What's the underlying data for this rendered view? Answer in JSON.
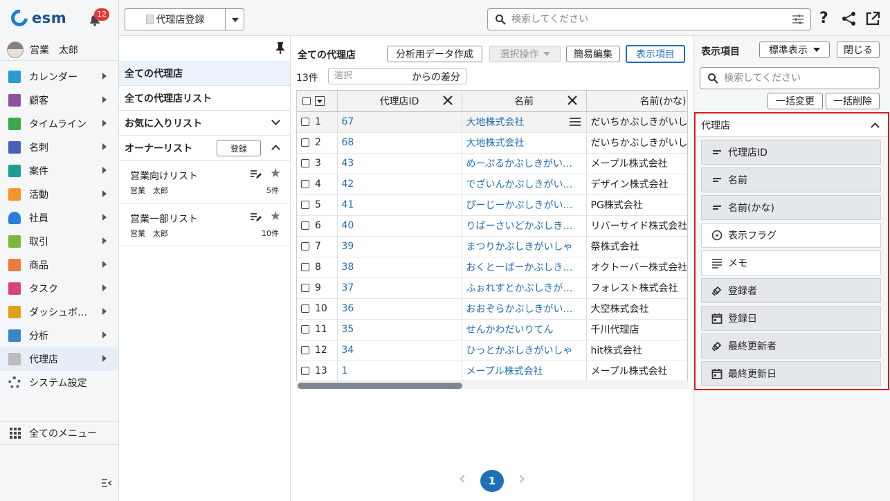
{
  "app": {
    "logo_text": "esm",
    "notification_count": "12"
  },
  "user": {
    "name": "営業　太郎"
  },
  "nav": {
    "items": [
      {
        "label": "カレンダー",
        "icon": "calendar-icon",
        "color": "#2a9bd6",
        "arrow": true
      },
      {
        "label": "顧客",
        "icon": "building-icon",
        "color": "#8e4f9e",
        "arrow": true
      },
      {
        "label": "タイムライン",
        "icon": "chat-icon",
        "color": "#3ba84a",
        "arrow": true
      },
      {
        "label": "名刺",
        "icon": "card-icon",
        "color": "#4a5fb8",
        "arrow": true
      },
      {
        "label": "案件",
        "icon": "folder-icon",
        "color": "#1f9e8e",
        "arrow": true
      },
      {
        "label": "活動",
        "icon": "clipboard-icon",
        "color": "#f0962a",
        "arrow": true
      },
      {
        "label": "社員",
        "icon": "person-icon",
        "color": "#2a7fd6",
        "arrow": true
      },
      {
        "label": "取引",
        "icon": "ledger-icon",
        "color": "#7bb83a",
        "arrow": true
      },
      {
        "label": "商品",
        "icon": "box-icon",
        "color": "#ef7a3a",
        "arrow": true
      },
      {
        "label": "タスク",
        "icon": "check-icon",
        "color": "#d6457a",
        "arrow": true
      },
      {
        "label": "ダッシュボ…",
        "icon": "dashboard-icon",
        "color": "#e0a01a",
        "arrow": true
      },
      {
        "label": "分析",
        "icon": "chart-icon",
        "color": "#3a86c8",
        "arrow": true
      },
      {
        "label": "代理店",
        "icon": "document-icon",
        "color": "#bcbcbc",
        "arrow": true
      },
      {
        "label": "システム設定",
        "icon": "gear-icon",
        "color": "#5a6170",
        "arrow": false
      }
    ],
    "all_menu": "全てのメニュー"
  },
  "topbar": {
    "new_button": "代理店登録",
    "search_placeholder": "検索してください",
    "help": "?"
  },
  "lists": {
    "all": "全ての代理店",
    "all_list": "全ての代理店リスト",
    "favorites": "お気に入りリスト",
    "owner": "オーナーリスト",
    "register": "登録",
    "owner_lists": [
      {
        "name": "営業向けリスト",
        "user": "営業　太郎",
        "count": "5件"
      },
      {
        "name": "営業一部リスト",
        "user": "営業　太郎",
        "count": "10件"
      }
    ]
  },
  "main": {
    "title": "全ての代理店",
    "btn_analysis": "分析用データ作成",
    "btn_select": "選択操作",
    "btn_quickedit": "簡易編集",
    "btn_display": "表示項目",
    "count": "13件",
    "diff_placeholder": "選択",
    "diff_suffix": "からの差分",
    "columns": [
      "代理店ID",
      "名前",
      "名前(かな)"
    ],
    "rows": [
      {
        "n": "1",
        "id": "67",
        "name": "大地株式会社",
        "kana": "だいちかぶしきがいしゃ"
      },
      {
        "n": "2",
        "id": "68",
        "name": "大地株式会社",
        "kana": "だいちかぶしきがいしゃ"
      },
      {
        "n": "3",
        "id": "43",
        "name": "めーぷるかぶしきがいしゃ",
        "kana": "メープル株式会社"
      },
      {
        "n": "4",
        "id": "42",
        "name": "でざいんかぶしきがいしゃ",
        "kana": "デザイン株式会社"
      },
      {
        "n": "5",
        "id": "41",
        "name": "ぴーじーかぶしきがいしゃ",
        "kana": "PG株式会社"
      },
      {
        "n": "6",
        "id": "40",
        "name": "りばーさいどかぶしきがいしゃ",
        "kana": "リバーサイド株式会社"
      },
      {
        "n": "7",
        "id": "39",
        "name": "まつりかぶしきがいしゃ",
        "kana": "祭株式会社"
      },
      {
        "n": "8",
        "id": "38",
        "name": "おくとーばーかぶしきがいしゃ",
        "kana": "オクトーバー株式会社"
      },
      {
        "n": "9",
        "id": "37",
        "name": "ふぉれすとかぶしきがいしゃ",
        "kana": "フォレスト株式会社"
      },
      {
        "n": "10",
        "id": "36",
        "name": "おおぞらかぶしきがいしゃ",
        "kana": "大空株式会社"
      },
      {
        "n": "11",
        "id": "35",
        "name": "せんかわだいりてん",
        "kana": "千川代理店"
      },
      {
        "n": "12",
        "id": "34",
        "name": "ひっとかぶしきがいしゃ",
        "kana": "hit株式会社"
      },
      {
        "n": "13",
        "id": "1",
        "name": "メープル株式会社",
        "kana": "メープル株式会社"
      }
    ],
    "page": "1"
  },
  "right": {
    "title": "表示項目",
    "standard": "標準表示",
    "close": "閉じる",
    "search_placeholder": "検索してください",
    "bulk_change": "一括変更",
    "bulk_delete": "一括削除",
    "group": "代理店",
    "fields": [
      {
        "label": "代理店ID",
        "icon": "text-field-icon",
        "on": false
      },
      {
        "label": "名前",
        "icon": "text-field-icon",
        "on": false
      },
      {
        "label": "名前(かな)",
        "icon": "text-field-icon",
        "on": false
      },
      {
        "label": "表示フラグ",
        "icon": "dropdown-circle-icon",
        "on": true
      },
      {
        "label": "メモ",
        "icon": "multiline-icon",
        "on": true
      },
      {
        "label": "登録者",
        "icon": "tag-icon",
        "on": false
      },
      {
        "label": "登録日",
        "icon": "calendar-date-icon",
        "on": false
      },
      {
        "label": "最終更新者",
        "icon": "tag-icon",
        "on": false
      },
      {
        "label": "最終更新日",
        "icon": "calendar-date-icon",
        "on": false
      }
    ]
  }
}
